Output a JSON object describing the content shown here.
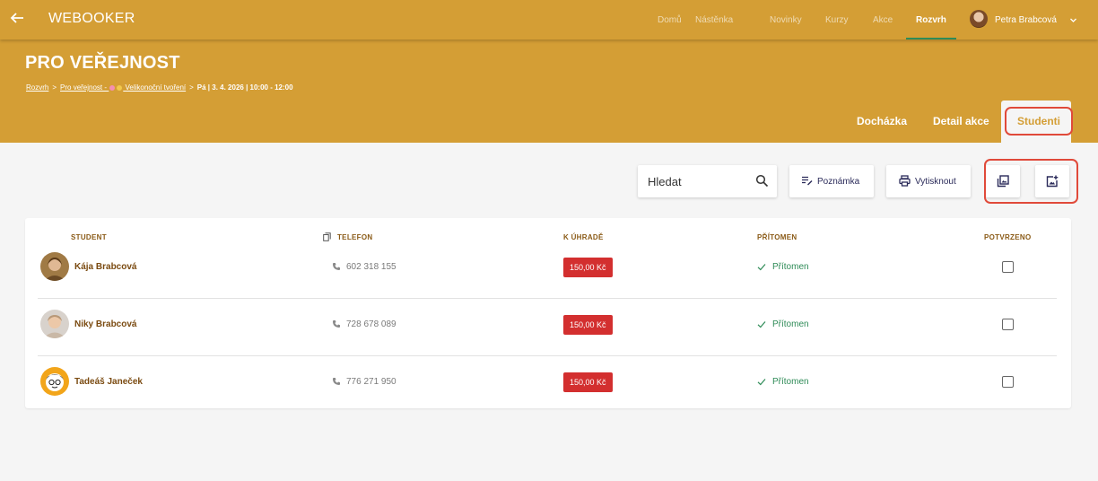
{
  "app": {
    "brand": "WEBOOKER",
    "accent_color": "#d49e35",
    "nav": [
      {
        "label": "Domů",
        "active": false
      },
      {
        "label": "Nástěnka",
        "active": false
      },
      {
        "label": "Novinky",
        "active": false
      },
      {
        "label": "Kurzy",
        "active": false
      },
      {
        "label": "Akce",
        "active": false
      },
      {
        "label": "Rozvrh",
        "active": true
      }
    ],
    "user_name": "Petra Brabcová"
  },
  "header": {
    "title": "PRO VEŘEJNOST",
    "breadcrumb": {
      "item1": "Rozvrh",
      "item2_prefix": "Pro veřejnost -",
      "item2_suffix": "Velikonoční tvoření",
      "separator": ">",
      "current": "Pá | 3. 4. 2026 | 10:00 - 12:00"
    },
    "tabs": {
      "attendance": "Docházka",
      "event_detail": "Detail akce",
      "students": "Studenti",
      "active_tab": "Studenti"
    }
  },
  "toolbar": {
    "search_placeholder": "Hledat",
    "note_label": "Poznámka",
    "print_label": "Vytisknout",
    "icons": [
      "search-icon",
      "note-icon",
      "print-icon",
      "gallery-icon",
      "add-photo-icon"
    ]
  },
  "table": {
    "headers": {
      "student": "STUDENT",
      "phone": "TELEFON",
      "to_pay": "K ÚHRADĚ",
      "present": "PŘÍTOMEN",
      "confirmed": "POTVRZENO"
    },
    "rows": [
      {
        "name": "Kája Brabcová",
        "phone": "602 318 155",
        "price": "150,00 Kč",
        "status": "Přítomen",
        "confirmed": false
      },
      {
        "name": "Niky Brabcová",
        "phone": "728 678 089",
        "price": "150,00 Kč",
        "status": "Přítomen",
        "confirmed": false
      },
      {
        "name": "Tadeáš Janeček",
        "phone": "776 271 950",
        "price": "150,00 Kč",
        "status": "Přítomen",
        "confirmed": false
      }
    ],
    "price_badge_color": "#d32f2f",
    "status_color": "#2e8b57"
  }
}
